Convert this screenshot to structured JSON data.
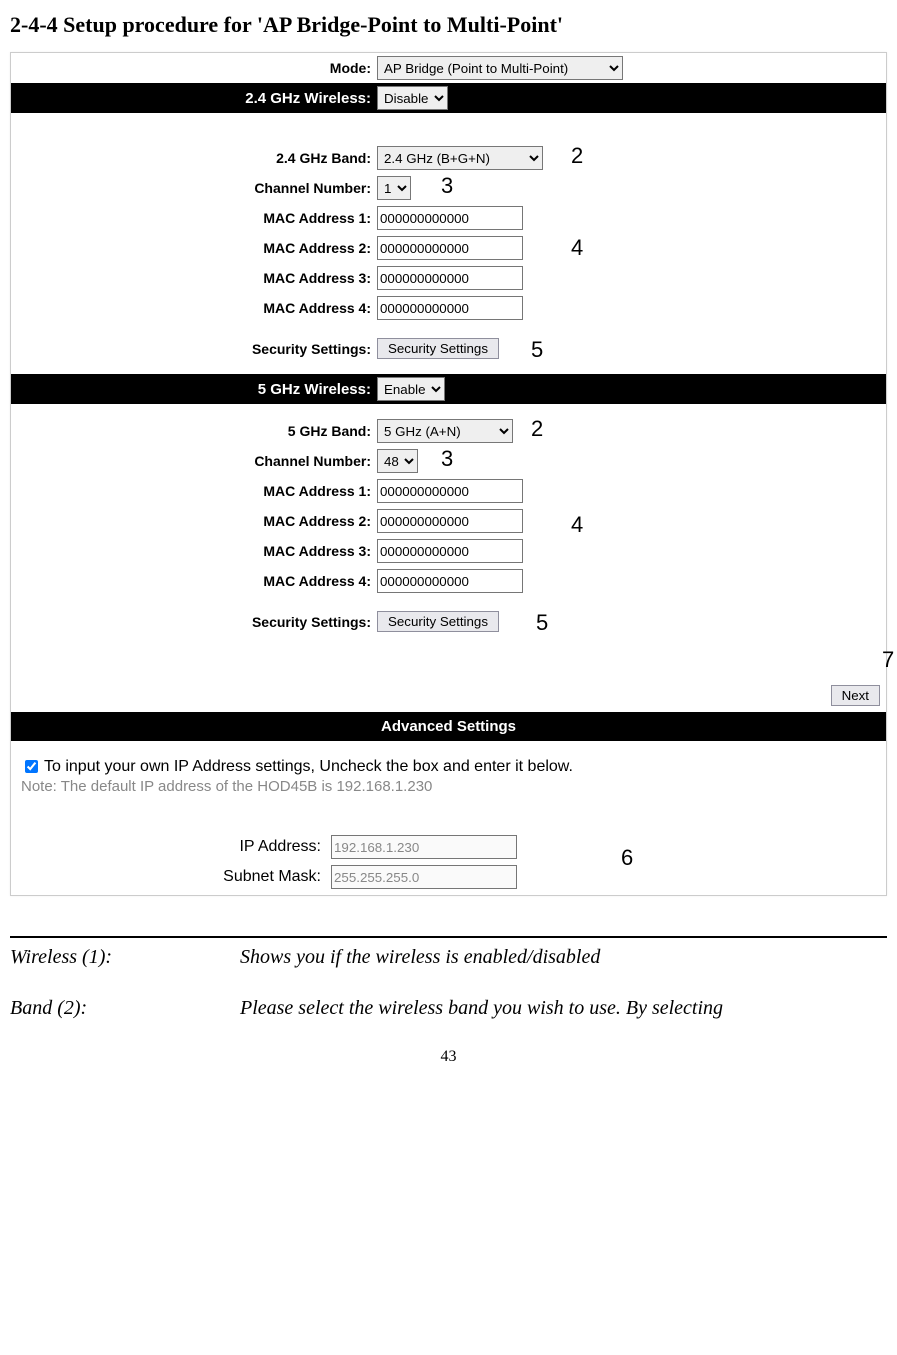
{
  "title": "2-4-4 Setup procedure for 'AP Bridge-Point to Multi-Point'",
  "mode": {
    "label": "Mode:",
    "value": "AP Bridge (Point to Multi-Point)"
  },
  "g24": {
    "header": "2.4 GHz Wireless:",
    "enable": "Disable",
    "band_label": "2.4 GHz Band:",
    "band_value": "2.4 GHz (B+G+N)",
    "chan_label": "Channel Number:",
    "chan_value": "1",
    "mac_labels": [
      "MAC Address 1:",
      "MAC Address 2:",
      "MAC Address 3:",
      "MAC Address 4:"
    ],
    "mac_values": [
      "000000000000",
      "000000000000",
      "000000000000",
      "000000000000"
    ],
    "sec_label": "Security Settings:",
    "sec_button": "Security Settings"
  },
  "g5": {
    "header": "5 GHz Wireless:",
    "enable": "Enable",
    "band_label": "5 GHz Band:",
    "band_value": "5 GHz (A+N)",
    "chan_label": "Channel Number:",
    "chan_value": "48",
    "mac_labels": [
      "MAC Address 1:",
      "MAC Address 2:",
      "MAC Address 3:",
      "MAC Address 4:"
    ],
    "mac_values": [
      "000000000000",
      "000000000000",
      "000000000000",
      "000000000000"
    ],
    "sec_label": "Security Settings:",
    "sec_button": "Security Settings"
  },
  "next_label": "Next",
  "adv": {
    "header": "Advanced Settings",
    "check_text": "To input your own IP Address settings, Uncheck the box and enter it below.",
    "note": "Note: The default IP address of the HOD45B is 192.168.1.230",
    "ip_label": "IP Address:",
    "ip_value": "192.168.1.230",
    "mask_label": "Subnet Mask:",
    "mask_value": "255.255.255.0"
  },
  "ann": {
    "g24_band": "2",
    "g24_chan": "3",
    "g24_mac": "4",
    "g24_sec": "5",
    "g5_band": "2",
    "g5_chan": "3",
    "g5_mac": "4",
    "g5_sec": "5",
    "next": "7",
    "ip": "6"
  },
  "desc": {
    "row1_key": "Wireless (1):",
    "row1_val": "Shows you if the wireless is enabled/disabled",
    "row2_key": "Band (2):",
    "row2_val": "Please select the wireless band you wish to use. By selecting"
  },
  "page_num": "43"
}
